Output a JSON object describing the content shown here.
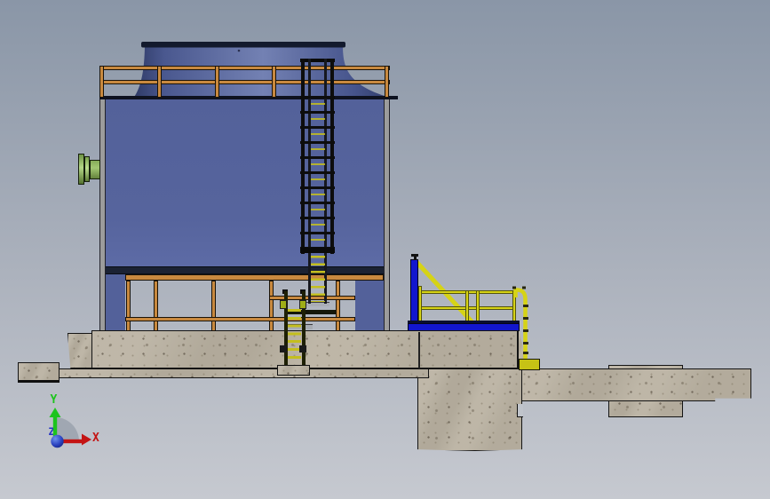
{
  "viewport": {
    "type": "3d-cad-side-view",
    "triad": {
      "x_label": "X",
      "y_label": "Y",
      "z_label": "Z"
    }
  },
  "palette": {
    "bg_top": "#8A96A7",
    "bg_mid": "#ACB2BD",
    "bg_bottom": "#C6C9D0",
    "tank_blue": "#53619A",
    "tank_dark_band": "#1B2233",
    "tank_edge": "#0E1220",
    "shroud_dark": "#2E3A66",
    "shroud_light": "#7381B3",
    "shroud_rim": "#131A2D",
    "gray_strip": "#9C9C9C",
    "rail_orange": "#C8893F",
    "cage_black": "#0D0D0D",
    "rung_yellow": "#C4BF1E",
    "ladder_olive": "#1E2005",
    "safety_yellow": "#D6D316",
    "platform_blue": "#1216CE",
    "flange_green": "#A3C873",
    "flange_dark": "#16200C",
    "concrete": "#BAB2A2",
    "concrete_edge": "#141414",
    "triad_x_red": "#C41414",
    "triad_y_green": "#1DC41D",
    "triad_z_blue": "#2433C4",
    "origin_blue": "#1A2CA0",
    "arc_gray": "#99A0AB"
  },
  "parts": [
    {
      "name": "fan-shroud",
      "color": "#53619A"
    },
    {
      "name": "cooling-tower-shell",
      "color": "#53619A"
    },
    {
      "name": "roof-handrail",
      "color": "#C8893F"
    },
    {
      "name": "caged-access-ladder",
      "color": "#0D0D0D"
    },
    {
      "name": "inlet-flange",
      "color": "#A3C873"
    },
    {
      "name": "support-frame",
      "color": "#C8893F"
    },
    {
      "name": "lower-access-ladder",
      "color": "#C4BF1E"
    },
    {
      "name": "access-platform",
      "color": "#1216CE"
    },
    {
      "name": "platform-handrail",
      "color": "#D6D316"
    },
    {
      "name": "gooseneck-pipe",
      "color": "#D6D316"
    },
    {
      "name": "junction-box",
      "color": "#C6C215"
    },
    {
      "name": "concrete-foundation",
      "color": "#BAB2A2"
    },
    {
      "name": "view-orientation-triad",
      "color": "#C41414"
    }
  ]
}
